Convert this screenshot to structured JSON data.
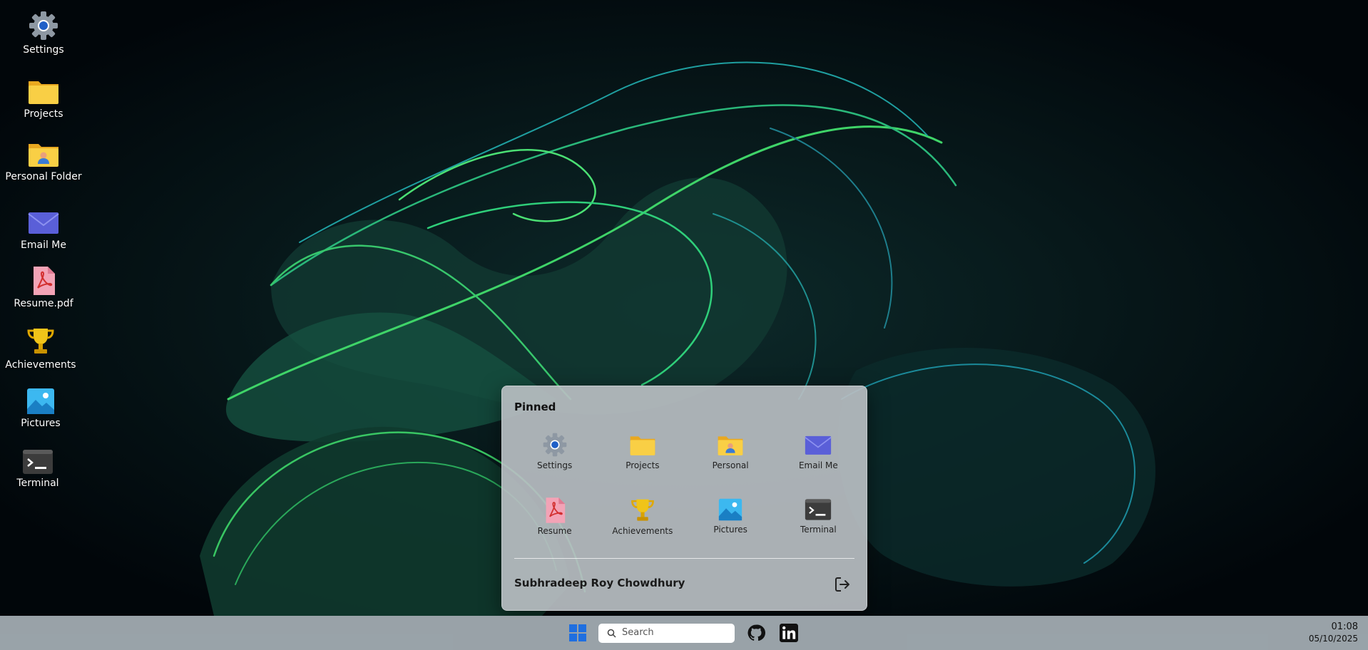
{
  "desktop": {
    "icons": [
      {
        "label": "Settings",
        "icon": "gear-icon"
      },
      {
        "label": "Projects",
        "icon": "folder-icon"
      },
      {
        "label": "Personal Folder",
        "icon": "user-folder-icon"
      },
      {
        "label": "Email Me",
        "icon": "mail-icon"
      },
      {
        "label": "Resume.pdf",
        "icon": "pdf-icon"
      },
      {
        "label": "Achievements",
        "icon": "trophy-icon"
      },
      {
        "label": "Pictures",
        "icon": "image-icon"
      },
      {
        "label": "Terminal",
        "icon": "terminal-icon"
      }
    ]
  },
  "start_menu": {
    "pinned_title": "Pinned",
    "pinned": [
      {
        "label": "Settings",
        "icon": "gear-icon"
      },
      {
        "label": "Projects",
        "icon": "folder-icon"
      },
      {
        "label": "Personal",
        "icon": "user-folder-icon"
      },
      {
        "label": "Email Me",
        "icon": "mail-icon"
      },
      {
        "label": "Resume",
        "icon": "pdf-icon"
      },
      {
        "label": "Achievements",
        "icon": "trophy-icon"
      },
      {
        "label": "Pictures",
        "icon": "image-icon"
      },
      {
        "label": "Terminal",
        "icon": "terminal-icon"
      }
    ],
    "user_name": "Subhradeep Roy Chowdhury",
    "logout_icon": "logout-icon"
  },
  "taskbar": {
    "start_icon": "windows-logo-icon",
    "search_placeholder": "Search",
    "apps": [
      {
        "icon": "github-icon"
      },
      {
        "icon": "linkedin-icon"
      }
    ],
    "time": "01:08",
    "date": "05/10/2025"
  },
  "colors": {
    "accent": "#1f6fe0",
    "folder": "#f7c948",
    "mail": "#5b5bd6",
    "pdf": "#e23b3b",
    "trophy": "#e0b800"
  }
}
